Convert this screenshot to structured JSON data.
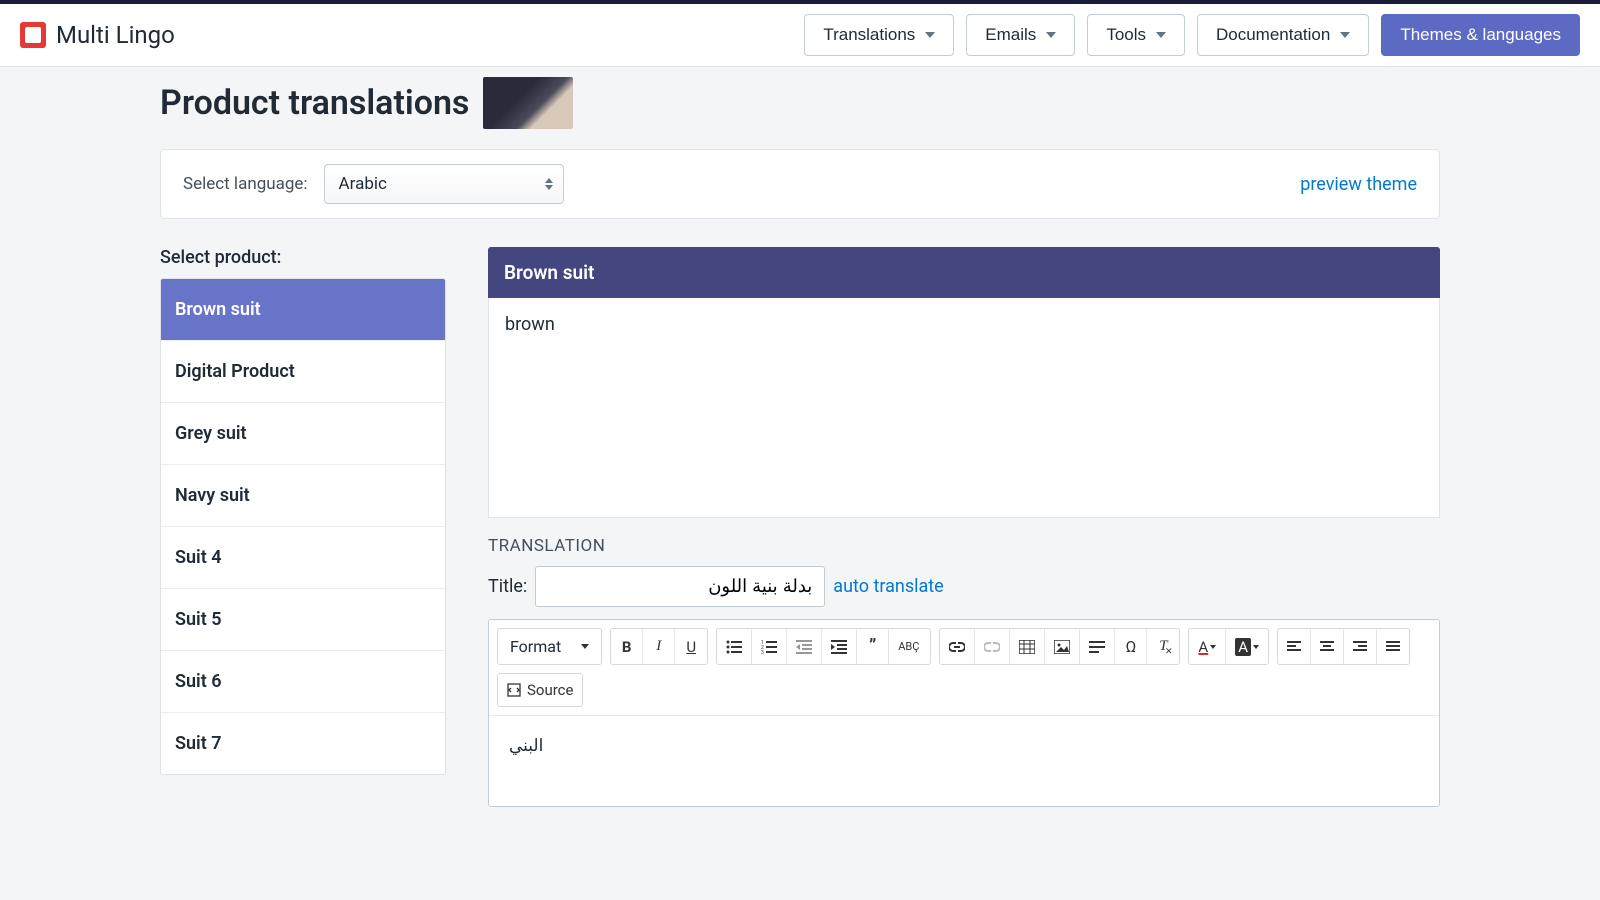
{
  "brand": {
    "name": "Multi Lingo"
  },
  "nav": {
    "translations": "Translations",
    "emails": "Emails",
    "tools": "Tools",
    "documentation": "Documentation",
    "themes": "Themes & languages"
  },
  "page": {
    "title": "Product translations"
  },
  "language_bar": {
    "label": "Select language:",
    "selected": "Arabic",
    "preview_link": "preview theme"
  },
  "sidebar": {
    "title": "Select product:",
    "items": [
      {
        "label": "Brown suit",
        "active": true
      },
      {
        "label": "Digital Product",
        "active": false
      },
      {
        "label": "Grey suit",
        "active": false
      },
      {
        "label": "Navy suit",
        "active": false
      },
      {
        "label": "Suit 4",
        "active": false
      },
      {
        "label": "Suit 5",
        "active": false
      },
      {
        "label": "Suit 6",
        "active": false
      },
      {
        "label": "Suit 7",
        "active": false
      }
    ]
  },
  "original": {
    "title": "Brown suit",
    "body": "brown"
  },
  "translation": {
    "section_label": "TRANSLATION",
    "title_label": "Title:",
    "title_value": "بدلة بنية اللون",
    "auto_link": "auto translate",
    "body": "البني"
  },
  "editor_toolbar": {
    "format": "Format",
    "source": "Source"
  }
}
